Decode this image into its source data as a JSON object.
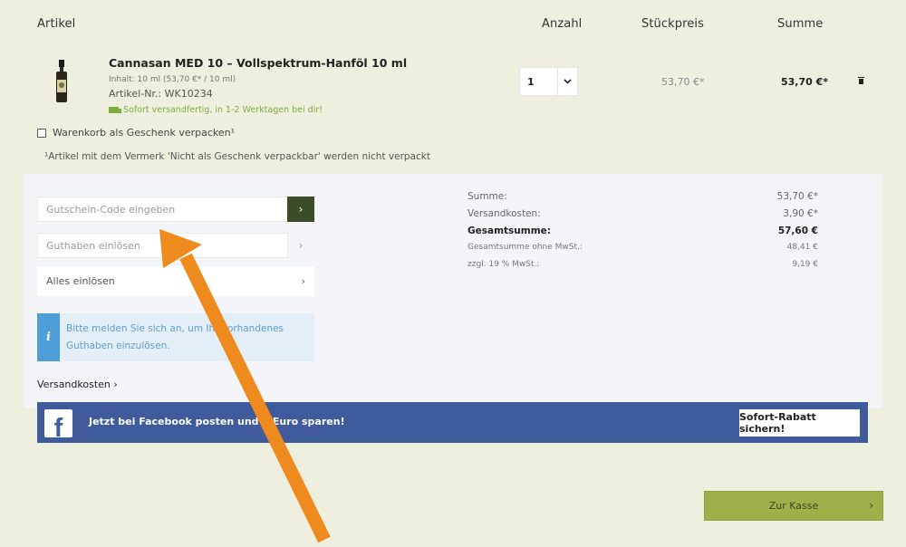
{
  "headers": {
    "article": "Artikel",
    "quantity": "Anzahl",
    "unit_price": "Stückpreis",
    "sum": "Summe"
  },
  "product": {
    "name": "Cannasan MED 10 – Vollspektrum-Hanföl 10 ml",
    "content": "Inhalt: 10 ml (53,70 €* / 10 ml)",
    "article_nr": "Artikel-Nr.: WK10234",
    "shipping_info": "Sofort versandfertig, in 1-2 Werktagen bei dir!",
    "quantity": "1",
    "unit_price": "53,70 €*",
    "sum": "53,70 €*"
  },
  "gift": {
    "label": "Warenkorb als Geschenk verpacken¹",
    "note": "¹Artikel mit dem Vermerk 'Nicht als Geschenk verpackbar' werden nicht verpackt"
  },
  "voucher": {
    "placeholder": "Gutschein-Code eingeben"
  },
  "credit": {
    "placeholder": "Guthaben einlösen"
  },
  "redeem_all": "Alles einlösen",
  "info_text": "Bitte melden Sie sich an, um Ihr vorhandenes Guthaben einzulösen.",
  "shipping_costs_link": "Versandkosten",
  "summary": {
    "sum_label": "Summe:",
    "sum_value": "53,70 €*",
    "shipping_label": "Versandkosten:",
    "shipping_value": "3,90 €*",
    "total_label": "Gesamtsumme:",
    "total_value": "57,60 €",
    "net_label": "Gesamtsumme ohne MwSt.:",
    "net_value": "48,41 €",
    "vat_label": "zzgl. 19 % MwSt.:",
    "vat_value": "9,19 €"
  },
  "facebook": {
    "text": "Jetzt bei Facebook posten und 2 Euro sparen!",
    "cta": "Sofort-Rabatt sichern!"
  },
  "checkout_label": "Zur Kasse",
  "colors": {
    "accent": "#3a4c28",
    "checkout": "#9fb04a",
    "facebook": "#3f5b9c",
    "arrow": "#ef8a1f",
    "info": "#4e9fd8"
  }
}
